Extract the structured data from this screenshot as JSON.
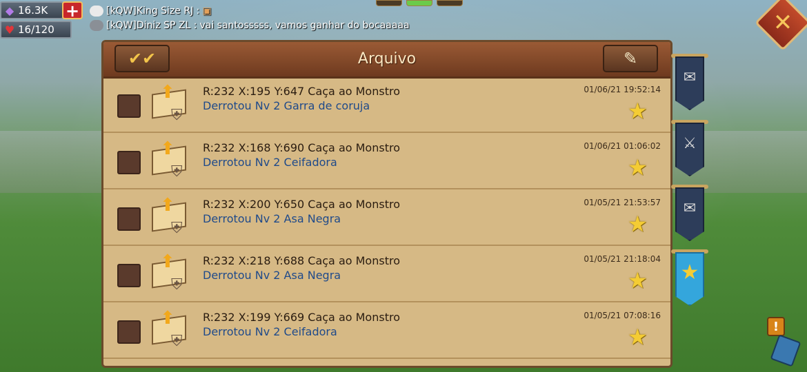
{
  "resources": {
    "gems": "16.3K",
    "stamina": "16/120",
    "plus_label": "+"
  },
  "chat": [
    {
      "sender": "[kQW]King Size RJ :",
      "message": ""
    },
    {
      "sender": "[kQW]Diniz SP ZL :",
      "message": "vai santosssss, vamos ganhar do bocaaaaa"
    }
  ],
  "panel": {
    "title": "Arquivo",
    "select_all_icon": "check-all-icon",
    "compose_icon": "scroll-quill-icon"
  },
  "close_label": "✕",
  "reports": [
    {
      "title": "R:232 X:195 Y:647 Caça ao Monstro",
      "detail": "Derrotou Nv 2 Garra de coruja",
      "timestamp": "01/06/21 19:52:14",
      "favorite": true
    },
    {
      "title": "R:232 X:168 Y:690 Caça ao Monstro",
      "detail": "Derrotou Nv 2 Ceifadora",
      "timestamp": "01/06/21 01:06:02",
      "favorite": true
    },
    {
      "title": "R:232 X:200 Y:650 Caça ao Monstro",
      "detail": "Derrotou Nv 2 Asa Negra",
      "timestamp": "01/05/21 21:53:57",
      "favorite": true
    },
    {
      "title": "R:232 X:218 Y:688 Caça ao Monstro",
      "detail": "Derrotou Nv 2 Asa Negra",
      "timestamp": "01/05/21 21:18:04",
      "favorite": true
    },
    {
      "title": "R:232 X:199 Y:669 Caça ao Monstro",
      "detail": "Derrotou Nv 2 Ceifadora",
      "timestamp": "01/05/21 07:08:16",
      "favorite": true
    }
  ],
  "side_tabs": [
    {
      "icon": "mail-settings-icon",
      "active": false
    },
    {
      "icon": "battle-report-icon",
      "active": false
    },
    {
      "icon": "mail-icon",
      "active": false
    },
    {
      "icon": "star-icon",
      "active": true
    }
  ],
  "colors": {
    "panel": "#d6b985",
    "header": "#7a4126",
    "active_tab": "#34a6dc",
    "star": "#f4cc34",
    "detail_text": "#1f4a8a"
  }
}
